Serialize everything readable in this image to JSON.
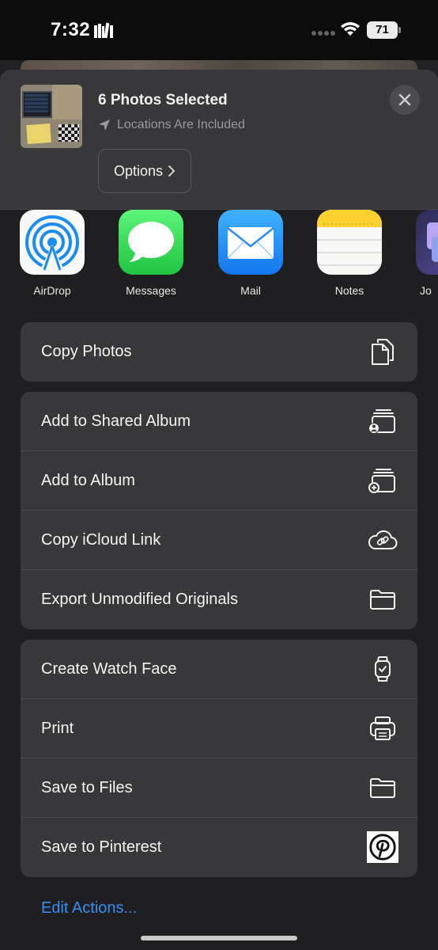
{
  "status_bar": {
    "time": "7:32",
    "battery": "71"
  },
  "header": {
    "title": "6 Photos Selected",
    "location": "Locations Are Included",
    "options_label": "Options"
  },
  "apps": [
    {
      "label": "AirDrop",
      "icon": "airdrop-icon"
    },
    {
      "label": "Messages",
      "icon": "messages-icon"
    },
    {
      "label": "Mail",
      "icon": "mail-icon"
    },
    {
      "label": "Notes",
      "icon": "notes-icon"
    },
    {
      "label": "Jo",
      "icon": "app-icon"
    }
  ],
  "actions": {
    "group1": [
      {
        "label": "Copy Photos",
        "icon": "copy-icon"
      }
    ],
    "group2": [
      {
        "label": "Add to Shared Album",
        "icon": "shared-album-icon"
      },
      {
        "label": "Add to Album",
        "icon": "add-album-icon"
      },
      {
        "label": "Copy iCloud Link",
        "icon": "icloud-link-icon"
      },
      {
        "label": "Export Unmodified Originals",
        "icon": "folder-icon"
      }
    ],
    "group3": [
      {
        "label": "Create Watch Face",
        "icon": "watch-icon"
      },
      {
        "label": "Print",
        "icon": "printer-icon"
      },
      {
        "label": "Save to Files",
        "icon": "folder-icon"
      },
      {
        "label": "Save to Pinterest",
        "icon": "pinterest-icon"
      }
    ]
  },
  "footer": {
    "edit_actions": "Edit Actions..."
  },
  "colors": {
    "accent": "#3a8ef6",
    "sheet": "#1f1f21",
    "cell": "#38383a"
  }
}
